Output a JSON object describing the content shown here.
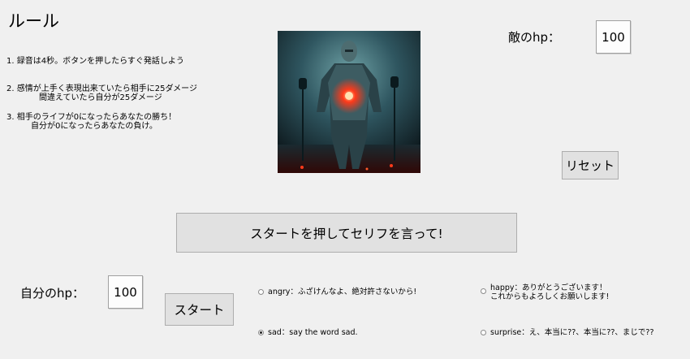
{
  "title": "ルール",
  "rules": [
    "1. 録音は4秒。ボタンを押したらすぐ発話しよう",
    "2. 感情が上手く表現出来ていたら相手に25ダメージ\n　　　　間違えていたら自分が25ダメージ",
    "3. 相手のライフが0になったらあなたの勝ち！\n　　　自分が0になったらあなたの負け。"
  ],
  "enemy": {
    "label": "敵のhp：",
    "value": "100"
  },
  "player": {
    "label": "自分のhp：",
    "value": "100"
  },
  "buttons": {
    "reset": "リセット",
    "prompt": "スタートを押してセリフを言って!",
    "start": "スタート"
  },
  "options": [
    {
      "text": "angry：ふざけんなよ、絶対許さないから!",
      "selected": false
    },
    {
      "text": "happy：ありがとうございます！\nこれからもよろしくお願いします!",
      "selected": false
    },
    {
      "text": "sad：say the word sad.",
      "selected": true
    },
    {
      "text": "surprise：え、本当に??、本当に??、まじで??",
      "selected": false
    }
  ],
  "colors": {
    "window_bg": "#f0f0f0",
    "button_bg": "#e1e1e1",
    "glow": "#ff3a1a"
  },
  "image": {
    "icon": "robot-figure-image"
  }
}
